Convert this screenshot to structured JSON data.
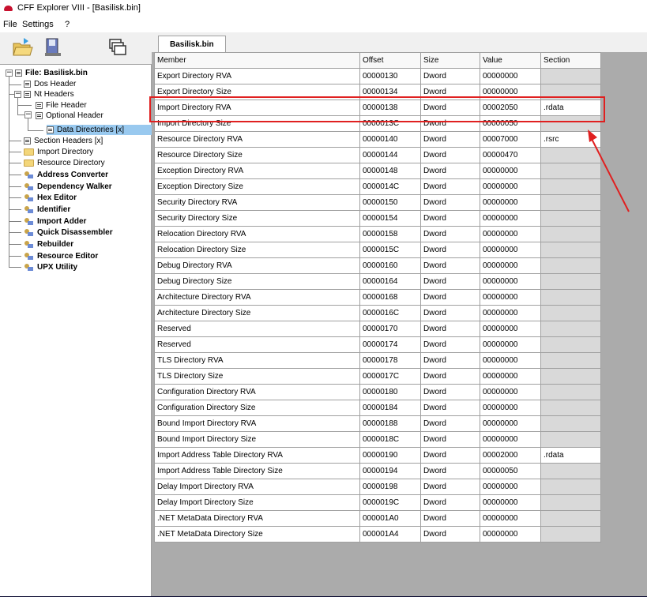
{
  "window": {
    "title": "CFF Explorer VIII - [Basilisk.bin]"
  },
  "menu": {
    "file": "File",
    "settings": "Settings",
    "help": "?"
  },
  "toolbar": {
    "open_icon": "open-folder-icon",
    "save_icon": "save-icon",
    "windows_icon": "windows-icon"
  },
  "tab": {
    "label": "Basilisk.bin"
  },
  "tree": {
    "root": "File: Basilisk.bin",
    "dos_header": "Dos Header",
    "nt_headers": "Nt Headers",
    "file_header": "File Header",
    "optional_header": "Optional Header",
    "data_directories": "Data Directories [x]",
    "section_headers": "Section Headers [x]",
    "import_directory": "Import Directory",
    "resource_directory": "Resource Directory",
    "address_converter": "Address Converter",
    "dependency_walker": "Dependency Walker",
    "hex_editor": "Hex Editor",
    "identifier": "Identifier",
    "import_adder": "Import Adder",
    "quick_disassembler": "Quick Disassembler",
    "rebuilder": "Rebuilder",
    "resource_editor": "Resource Editor",
    "upx_utility": "UPX Utility"
  },
  "table": {
    "headers": {
      "member": "Member",
      "offset": "Offset",
      "size": "Size",
      "value": "Value",
      "section": "Section"
    },
    "rows": [
      {
        "member": "Export Directory RVA",
        "offset": "00000130",
        "size": "Dword",
        "value": "00000000",
        "section": ""
      },
      {
        "member": "Export Directory Size",
        "offset": "00000134",
        "size": "Dword",
        "value": "00000000",
        "section": ""
      },
      {
        "member": "Import Directory RVA",
        "offset": "00000138",
        "size": "Dword",
        "value": "00002050",
        "section": ".rdata"
      },
      {
        "member": "Import Directory Size",
        "offset": "0000013C",
        "size": "Dword",
        "value": "00000050",
        "section": ""
      },
      {
        "member": "Resource Directory RVA",
        "offset": "00000140",
        "size": "Dword",
        "value": "00007000",
        "section": ".rsrc"
      },
      {
        "member": "Resource Directory Size",
        "offset": "00000144",
        "size": "Dword",
        "value": "00000470",
        "section": ""
      },
      {
        "member": "Exception Directory RVA",
        "offset": "00000148",
        "size": "Dword",
        "value": "00000000",
        "section": ""
      },
      {
        "member": "Exception Directory Size",
        "offset": "0000014C",
        "size": "Dword",
        "value": "00000000",
        "section": ""
      },
      {
        "member": "Security Directory RVA",
        "offset": "00000150",
        "size": "Dword",
        "value": "00000000",
        "section": ""
      },
      {
        "member": "Security Directory Size",
        "offset": "00000154",
        "size": "Dword",
        "value": "00000000",
        "section": ""
      },
      {
        "member": "Relocation Directory RVA",
        "offset": "00000158",
        "size": "Dword",
        "value": "00000000",
        "section": ""
      },
      {
        "member": "Relocation Directory Size",
        "offset": "0000015C",
        "size": "Dword",
        "value": "00000000",
        "section": ""
      },
      {
        "member": "Debug Directory RVA",
        "offset": "00000160",
        "size": "Dword",
        "value": "00000000",
        "section": ""
      },
      {
        "member": "Debug Directory Size",
        "offset": "00000164",
        "size": "Dword",
        "value": "00000000",
        "section": ""
      },
      {
        "member": "Architecture Directory RVA",
        "offset": "00000168",
        "size": "Dword",
        "value": "00000000",
        "section": ""
      },
      {
        "member": "Architecture Directory Size",
        "offset": "0000016C",
        "size": "Dword",
        "value": "00000000",
        "section": ""
      },
      {
        "member": "Reserved",
        "offset": "00000170",
        "size": "Dword",
        "value": "00000000",
        "section": ""
      },
      {
        "member": "Reserved",
        "offset": "00000174",
        "size": "Dword",
        "value": "00000000",
        "section": ""
      },
      {
        "member": "TLS Directory RVA",
        "offset": "00000178",
        "size": "Dword",
        "value": "00000000",
        "section": ""
      },
      {
        "member": "TLS Directory Size",
        "offset": "0000017C",
        "size": "Dword",
        "value": "00000000",
        "section": ""
      },
      {
        "member": "Configuration Directory RVA",
        "offset": "00000180",
        "size": "Dword",
        "value": "00000000",
        "section": ""
      },
      {
        "member": "Configuration Directory Size",
        "offset": "00000184",
        "size": "Dword",
        "value": "00000000",
        "section": ""
      },
      {
        "member": "Bound Import Directory RVA",
        "offset": "00000188",
        "size": "Dword",
        "value": "00000000",
        "section": ""
      },
      {
        "member": "Bound Import Directory Size",
        "offset": "0000018C",
        "size": "Dword",
        "value": "00000000",
        "section": ""
      },
      {
        "member": "Import Address Table Directory RVA",
        "offset": "00000190",
        "size": "Dword",
        "value": "00002000",
        "section": ".rdata"
      },
      {
        "member": "Import Address Table Directory Size",
        "offset": "00000194",
        "size": "Dword",
        "value": "00000050",
        "section": ""
      },
      {
        "member": "Delay Import Directory RVA",
        "offset": "00000198",
        "size": "Dword",
        "value": "00000000",
        "section": ""
      },
      {
        "member": "Delay Import Directory Size",
        "offset": "0000019C",
        "size": "Dword",
        "value": "00000000",
        "section": ""
      },
      {
        "member": ".NET MetaData Directory RVA",
        "offset": "000001A0",
        "size": "Dword",
        "value": "00000000",
        "section": ""
      },
      {
        "member": ".NET MetaData Directory Size",
        "offset": "000001A4",
        "size": "Dword",
        "value": "00000000",
        "section": ""
      }
    ]
  },
  "annotation": {
    "highlight_color": "#e02020",
    "highlighted_row": "Import Directory RVA"
  }
}
